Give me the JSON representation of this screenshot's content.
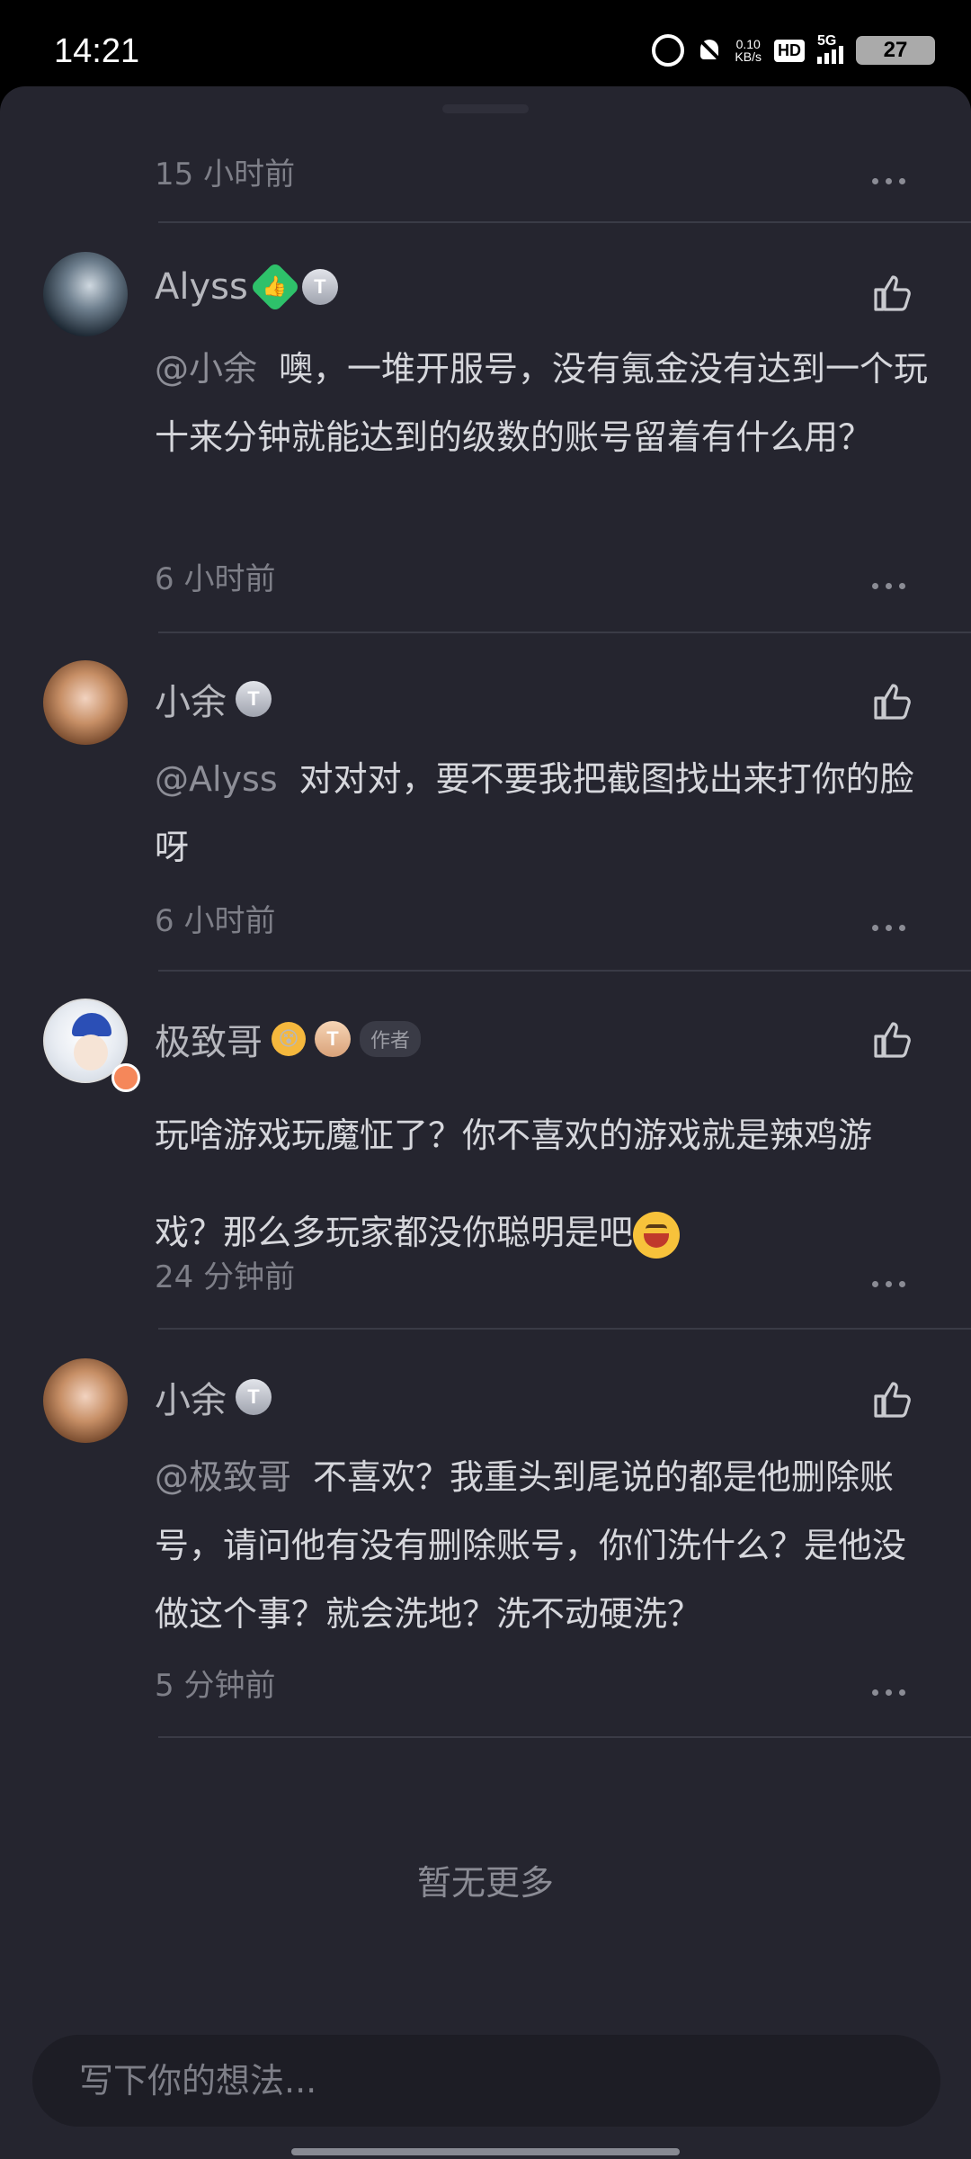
{
  "status_bar": {
    "time": "14:21",
    "net_speed_value": "0.10",
    "net_speed_unit": "KB/s",
    "hd_label": "HD",
    "network": "5G",
    "battery": "27"
  },
  "top_comment": {
    "time": "15 小时前"
  },
  "comments": [
    {
      "user": "Alyss",
      "level": "T",
      "mention": "@小余",
      "text": "噢，一堆开服号，没有氪金没有达到一个玩十来分钟就能达到的级数的账号留着有什么用？",
      "time": "6 小时前"
    },
    {
      "user": "小余",
      "level": "T",
      "mention": "@Alyss",
      "text": "对对对，要不要我把截图找出来打你的脸呀",
      "time": "6 小时前"
    },
    {
      "user": "极致哥",
      "level": "T",
      "author_tag": "作者",
      "text": "玩啥游戏玩魔怔了？你不喜欢的游戏就是辣鸡游戏？那么多玩家都没你聪明是吧",
      "time": "24 分钟前"
    },
    {
      "user": "小余",
      "level": "T",
      "mention": "@极致哥",
      "text": "不喜欢？我重头到尾说的都是他删除账号，请问他有没有删除账号，你们洗什么？是他没做这个事？就会洗地？洗不动硬洗？",
      "time": "5 分钟前"
    }
  ],
  "footer": {
    "no_more": "暂无更多",
    "input_placeholder": "写下你的想法..."
  },
  "colors": {
    "sheet_bg": "#25252f",
    "divider": "#3a3b46",
    "level_badge_green": "#2ec16a"
  }
}
